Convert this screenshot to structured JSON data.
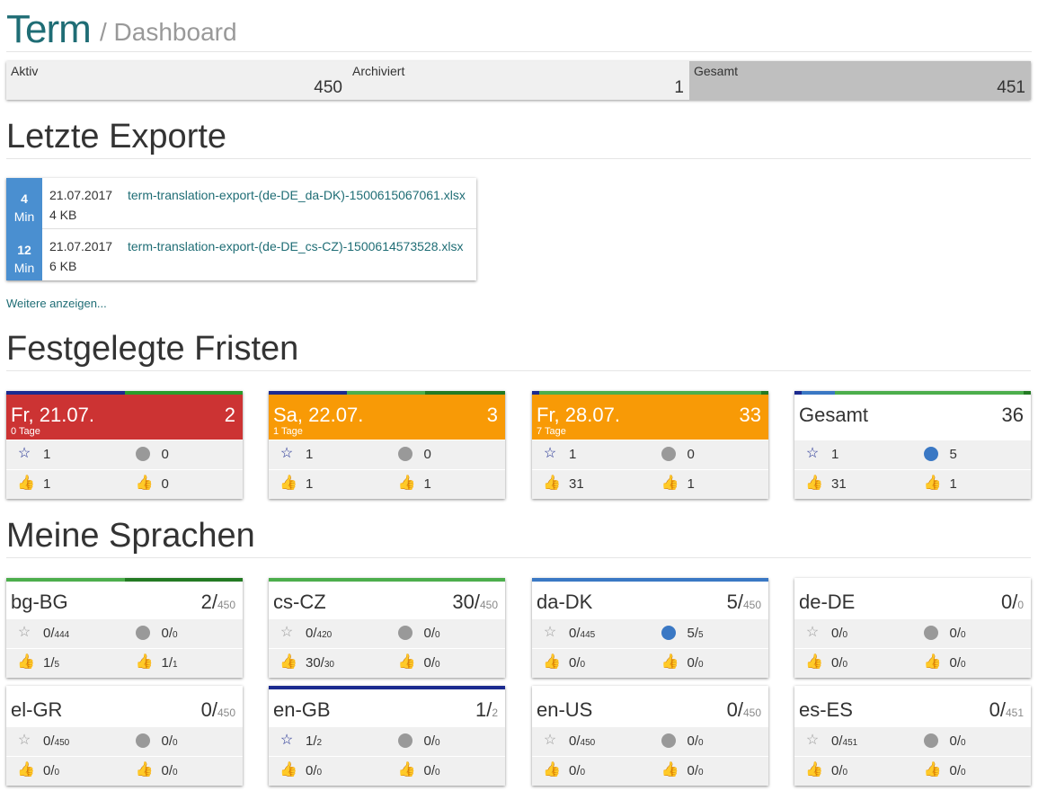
{
  "header": {
    "brand": "Term",
    "crumb": "/ Dashboard"
  },
  "stats": [
    {
      "label": "Aktiv",
      "value": "450"
    },
    {
      "label": "Archiviert",
      "value": "1"
    },
    {
      "label": "Gesamt",
      "value": "451"
    }
  ],
  "sections": {
    "exports": "Letzte Exporte",
    "deadlines": "Festgelegte Fristen",
    "languages": "Meine Sprachen"
  },
  "exports": [
    {
      "age_num": "4",
      "age_unit": "Min",
      "date": "21.07.2017",
      "size": "4 KB",
      "file": "term-translation-export-(de-DE_da-DK)-1500615067061.xlsx"
    },
    {
      "age_num": "12",
      "age_unit": "Min",
      "date": "21.07.2017",
      "size": "6 KB",
      "file": "term-translation-export-(de-DE_cs-CZ)-1500614573528.xlsx"
    }
  ],
  "more_link": "Weitere anzeigen...",
  "deadlines": [
    {
      "title": "Fr, 21.07.",
      "sub": "0 Tage",
      "count": "2",
      "star": "1",
      "globe": "0",
      "up1": "1",
      "up2": "0"
    },
    {
      "title": "Sa, 22.07.",
      "sub": "1 Tage",
      "count": "3",
      "star": "1",
      "globe": "0",
      "up1": "1",
      "up2": "1"
    },
    {
      "title": "Fr, 28.07.",
      "sub": "7 Tage",
      "count": "33",
      "star": "1",
      "globe": "0",
      "up1": "31",
      "up2": "1"
    },
    {
      "title": "Gesamt",
      "sub": "",
      "count": "36",
      "star": "1",
      "globe": "5",
      "up1": "31",
      "up2": "1"
    }
  ],
  "languages": [
    {
      "code": "bg-BG",
      "n": "2/",
      "d": "450",
      "star": "0/",
      "stard": "444",
      "globe": "0/",
      "globed": "0",
      "up1": "1/",
      "up1d": "5",
      "up2": "1/",
      "up2d": "1"
    },
    {
      "code": "cs-CZ",
      "n": "30/",
      "d": "450",
      "star": "0/",
      "stard": "420",
      "globe": "0/",
      "globed": "0",
      "up1": "30/",
      "up1d": "30",
      "up2": "0/",
      "up2d": "0"
    },
    {
      "code": "da-DK",
      "n": "5/",
      "d": "450",
      "star": "0/",
      "stard": "445",
      "globe": "5/",
      "globed": "5",
      "up1": "0/",
      "up1d": "0",
      "up2": "0/",
      "up2d": "0"
    },
    {
      "code": "de-DE",
      "n": "0/",
      "d": "0",
      "star": "0/",
      "stard": "0",
      "globe": "0/",
      "globed": "0",
      "up1": "0/",
      "up1d": "0",
      "up2": "0/",
      "up2d": "0"
    },
    {
      "code": "el-GR",
      "n": "0/",
      "d": "450",
      "star": "0/",
      "stard": "450",
      "globe": "0/",
      "globed": "0",
      "up1": "0/",
      "up1d": "0",
      "up2": "0/",
      "up2d": "0"
    },
    {
      "code": "en-GB",
      "n": "1/",
      "d": "2",
      "star": "1/",
      "stard": "2",
      "globe": "0/",
      "globed": "0",
      "up1": "0/",
      "up1d": "0",
      "up2": "0/",
      "up2d": "0"
    },
    {
      "code": "en-US",
      "n": "0/",
      "d": "450",
      "star": "0/",
      "stard": "450",
      "globe": "0/",
      "globed": "0",
      "up1": "0/",
      "up1d": "0",
      "up2": "0/",
      "up2d": "0"
    },
    {
      "code": "es-ES",
      "n": "0/",
      "d": "451",
      "star": "0/",
      "stard": "451",
      "globe": "0/",
      "globed": "0",
      "up1": "0/",
      "up1d": "0",
      "up2": "0/",
      "up2d": "0"
    }
  ],
  "colors": {
    "brand": "#1f6d75",
    "red": "#cc3333",
    "orange": "#f89a06",
    "navy": "#1b2a8f",
    "green": "#2a9c2a",
    "blue": "#4a8fd0"
  }
}
